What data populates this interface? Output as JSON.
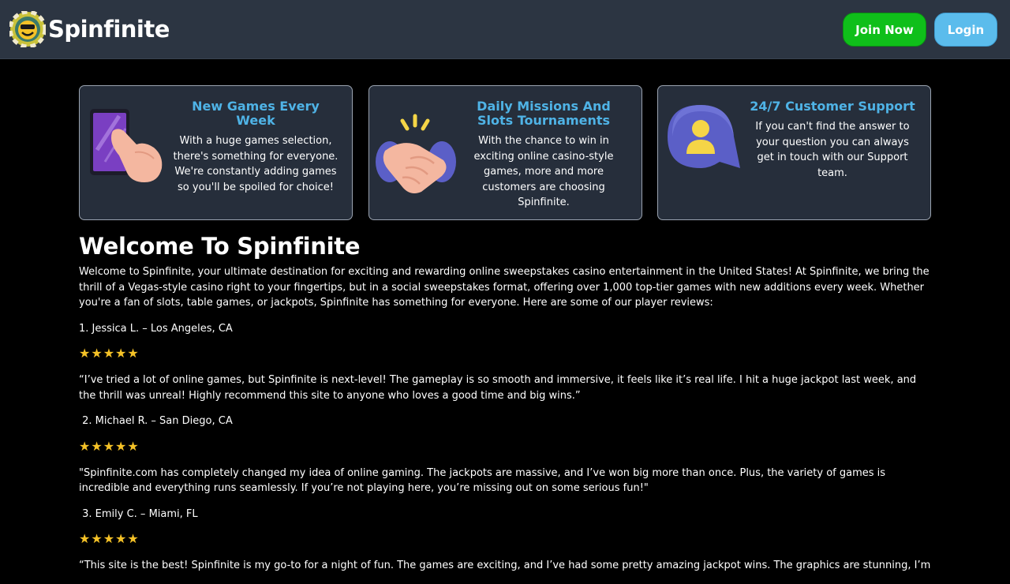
{
  "header": {
    "brand": "Spinfinite",
    "join_label": "Join Now",
    "login_label": "Login"
  },
  "features": [
    {
      "title": "New Games Every Week",
      "description": "With a huge games selection, there's something for everyone. We're constantly adding games so you'll be spoiled for choice!",
      "icon": "phone-tap-icon"
    },
    {
      "title": "Daily Missions And Slots Tournaments",
      "description": "With the chance to win in exciting online casino-style games, more and more customers are choosing Spinfinite.",
      "icon": "handshake-icon"
    },
    {
      "title": "24/7 Customer Support",
      "description": "If you can't find the answer to your question you can always get in touch with our Support team.",
      "icon": "support-chat-icon"
    }
  ],
  "main": {
    "title": "Welcome To Spinfinite",
    "intro": "Welcome to Spinfinite, your ultimate destination for exciting and rewarding online sweepstakes casino entertainment in the United States! At Spinfinite, we bring the thrill of a Vegas-style casino right to your fingertips, but in a social sweepstakes format, offering over 1,000 top-tier games with new additions every week. Whether you're a fan of slots, table games, or jackpots, Spinfinite has something for everyone. Here are some of our player reviews:",
    "reviews": [
      {
        "reviewer": "1. Jessica L. – Los Angeles, CA",
        "stars": "★★★★★",
        "rating": 5,
        "quote": "“I’ve tried a lot of online games, but Spinfinite is next-level! The gameplay is so smooth and immersive, it feels like it’s real life. I hit a huge jackpot last week, and the thrill was unreal! Highly recommend this site to anyone who loves a good time and big wins.”"
      },
      {
        "reviewer": " 2. Michael R. – San Diego, CA",
        "stars": "★★★★★",
        "rating": 5,
        "quote": "\"Spinfinite.com has completely changed my idea of online gaming. The jackpots are massive, and I’ve won big more than once. Plus, the variety of games is incredible and everything runs seamlessly. If you’re not playing here, you’re missing out on some serious fun!\""
      },
      {
        "reviewer": " 3. Emily C. – Miami, FL",
        "stars": "★★★★★",
        "rating": 5,
        "quote": "“This site is the best! Spinfinite is my go-to for a night of fun. The games are exciting, and I’ve had some pretty amazing jackpot wins. The graphics are stunning, I’m"
      }
    ]
  },
  "colors": {
    "header_bg": "#2c3542",
    "card_bg": "#262e3b",
    "accent_blue": "#4fb3e6",
    "join_green": "#0fbf1a",
    "login_blue": "#5bbcec",
    "star_gold": "#f5c227"
  }
}
